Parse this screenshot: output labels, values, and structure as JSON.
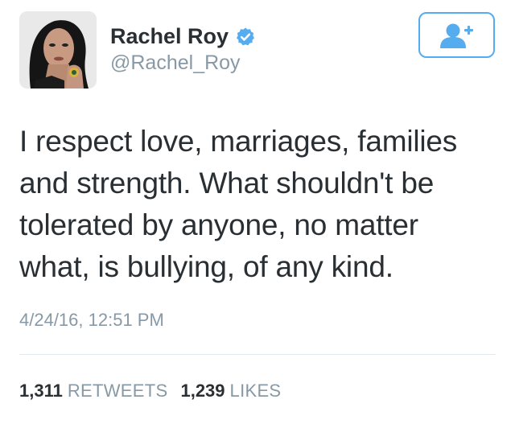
{
  "author": {
    "display_name": "Rachel Roy",
    "handle": "@Rachel_Roy",
    "verified": true,
    "verified_icon": "verified-badge-icon",
    "avatar_icon": "profile-photo"
  },
  "follow_button": {
    "icon": "add-user-icon"
  },
  "tweet": {
    "lines": [
      "I respect love, marriages, families",
      "and strength. What shouldn't be",
      "tolerated by anyone, no matter",
      "what, is bullying, of any kind."
    ],
    "timestamp": "4/24/16, 12:51 PM"
  },
  "stats": {
    "retweets_count": "1,311",
    "retweets_label": "RETWEETS",
    "likes_count": "1,239",
    "likes_label": "LIKES"
  },
  "colors": {
    "accent": "#55acee",
    "text": "#292f33",
    "muted": "#8899a6",
    "divider": "#e1e8ed"
  }
}
